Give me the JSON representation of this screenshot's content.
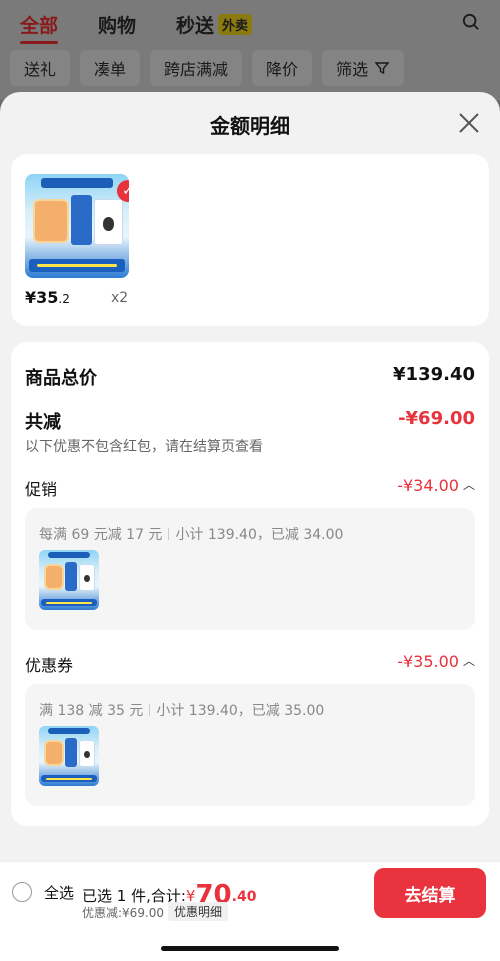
{
  "background": {
    "tabs": [
      {
        "label": "全部",
        "active": true
      },
      {
        "label": "购物",
        "active": false
      },
      {
        "label": "秒送",
        "active": false,
        "badge": "外卖"
      }
    ],
    "filters": [
      "送礼",
      "凑单",
      "跨店满减",
      "降价",
      "筛选"
    ]
  },
  "sheet": {
    "title": "金额明细"
  },
  "product": {
    "price_main": "¥35",
    "price_dec": ".2",
    "qty": "x2"
  },
  "detail": {
    "total_label": "商品总价",
    "total_value": "¥139.40",
    "reduce_label": "共减",
    "reduce_value": "-¥69.00",
    "note": "以下优惠不包含红包，请在结算页查看",
    "promo_label": "促销",
    "promo_value": "-¥34.00",
    "promo_rule": "每满 69 元减 17 元",
    "promo_subtotal": "小计 139.40，已减 34.00",
    "coupon_label": "优惠券",
    "coupon_value": "-¥35.00",
    "coupon_rule": "满 138 减 35 元",
    "coupon_subtotal": "小计 139.40，已减 35.00"
  },
  "bottom": {
    "select_all": "全选",
    "selected_info": "已选 1 件,合计:",
    "total_symbol": "¥",
    "total_int": "70",
    "total_dec": ".40",
    "discount_note": "优惠减:¥69.00",
    "detail_tag": "优惠明细",
    "checkout": "去结算"
  },
  "colors": {
    "accent": "#e8323c",
    "sheet_bg": "#f2f2f2"
  }
}
